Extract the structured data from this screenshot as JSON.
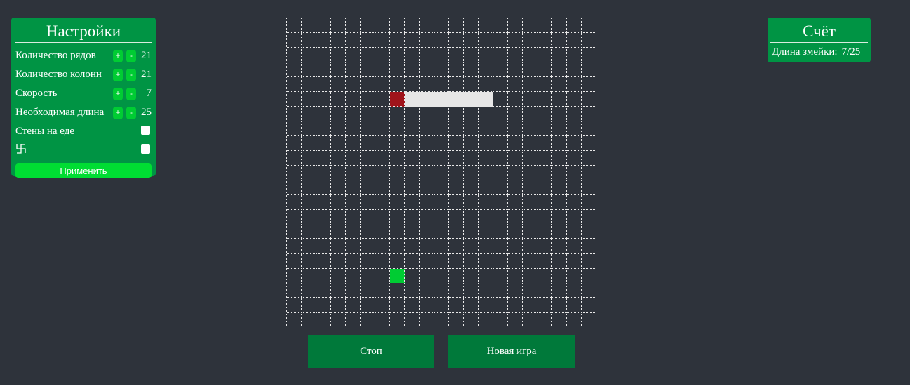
{
  "settings": {
    "title": "Настройки",
    "rows": [
      {
        "label": "Количество рядов",
        "plus": "+",
        "minus": "-",
        "value": "21"
      },
      {
        "label": "Количество колонн",
        "plus": "+",
        "minus": "-",
        "value": "21"
      },
      {
        "label": "Скорость",
        "plus": "+",
        "minus": "-",
        "value": "7"
      },
      {
        "label": "Необходимая длина",
        "plus": "+",
        "minus": "-",
        "value": "25"
      }
    ],
    "walls_on_food_label": "Стены на еде",
    "walls_on_food_checked": false,
    "symbol_option_icon": "swastika-icon",
    "symbol_option_checked": false,
    "apply_label": "Применить"
  },
  "score": {
    "title": "Счёт",
    "length_label": "Длина змейки:",
    "length_value": "7/25"
  },
  "board": {
    "rows": 21,
    "cols": 21,
    "snake": {
      "head": [
        5,
        7
      ],
      "body": [
        [
          5,
          8
        ],
        [
          5,
          9
        ],
        [
          5,
          10
        ],
        [
          5,
          11
        ],
        [
          5,
          12
        ],
        [
          5,
          13
        ]
      ]
    },
    "food": [
      17,
      7
    ],
    "colors": {
      "background": "#2e333b",
      "head": "#a0141b",
      "body": "#e6e6e6",
      "food": "#00cc33",
      "grid": "#e8e8e8"
    }
  },
  "controls": {
    "stop_label": "Стоп",
    "new_game_label": "Новая игра"
  }
}
